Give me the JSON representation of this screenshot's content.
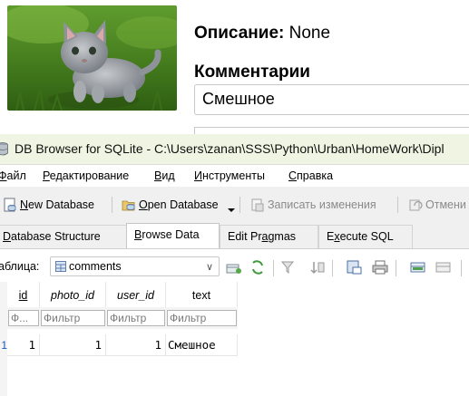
{
  "webpage": {
    "description_label": "Описание:",
    "description_value": "None",
    "comments_label": "Комментарии",
    "comment_text": "Смешное"
  },
  "window": {
    "title": "DB Browser for SQLite - C:\\Users\\zanan\\SSS\\Python\\Urban\\HomeWork\\Dipl"
  },
  "menu": [
    {
      "u": "Ф",
      "rest": "айл"
    },
    {
      "u": "Р",
      "rest": "едактирование"
    },
    {
      "u": "В",
      "rest": "ид"
    },
    {
      "u": "И",
      "rest": "нструменты"
    },
    {
      "u": "С",
      "rest": "правка"
    }
  ],
  "toolbar": {
    "new_db_u": "N",
    "new_db_rest": "ew Database",
    "open_db_u": "O",
    "open_db_rest": "pen Database",
    "write_changes": "Записать изменения",
    "revert": "Отмени"
  },
  "tabs": {
    "structure_u": "D",
    "structure_rest": "atabase Structure",
    "browse_u": "B",
    "browse_rest": "rowse Data",
    "pragmas_pre": "Edit Pr",
    "pragmas_u": "a",
    "pragmas_post": "gmas",
    "sql_pre": "E",
    "sql_u": "x",
    "sql_post": "ecute SQL"
  },
  "browse": {
    "table_label": "аблица:",
    "table_value": "comments",
    "columns": [
      "id",
      "photo_id",
      "user_id",
      "text"
    ],
    "filter_placeholders": [
      "Ф...",
      "Фильтр",
      "Фильтр",
      "Фильтр"
    ],
    "row_number": "1",
    "row": [
      "1",
      "1",
      "1",
      "Смешное"
    ]
  },
  "colors": {
    "titlebar_bg": "#eff5e2",
    "row_number": "#1a57b8"
  }
}
